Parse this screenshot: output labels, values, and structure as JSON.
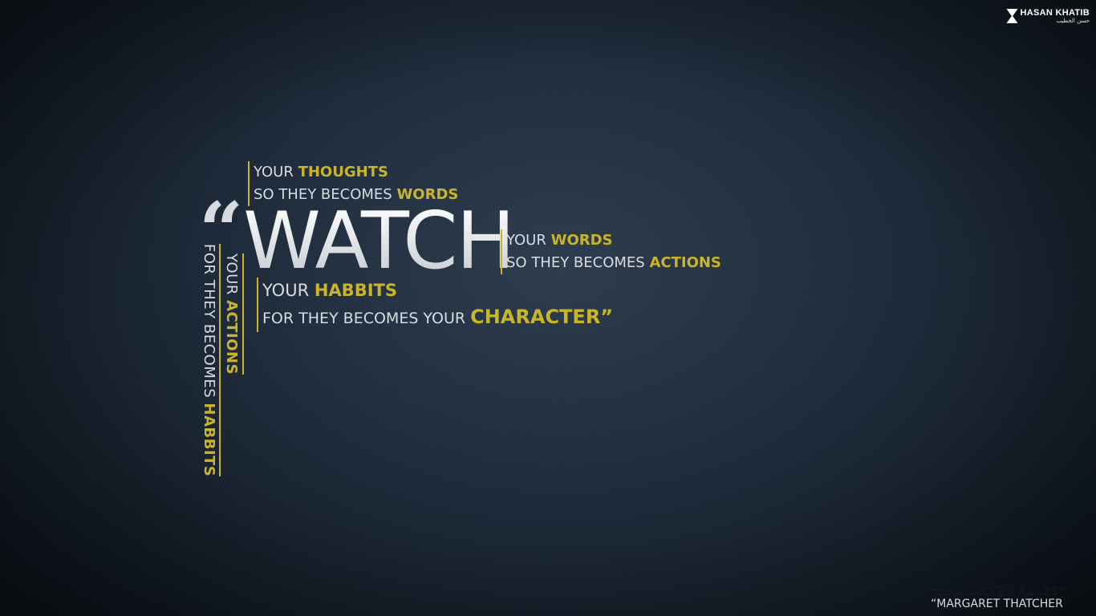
{
  "colors": {
    "accent": "#c8b52a",
    "text": "#d8dce0",
    "background": "#1c2836"
  },
  "logo": {
    "icon": "hk-logo-icon",
    "name": "HASAN KHATIB",
    "subtitle": "حسن الخطيب"
  },
  "quote": {
    "open_mark": "“",
    "main_word": "WATCH",
    "block_thoughts": {
      "line1_white": "YOUR ",
      "line1_yellow": "THOUGHTS",
      "line2_white": "SO THEY BECOMES ",
      "line2_yellow": "WORDS"
    },
    "block_words": {
      "line1_white": "YOUR ",
      "line1_yellow": "WORDS",
      "line2_white": "SO THEY BECOMES ",
      "line2_yellow": "ACTIONS"
    },
    "block_habits": {
      "line1_white": "YOUR ",
      "line1_yellow": "HABBITS",
      "line2_white": "FOR THEY BECOMES YOUR ",
      "line2_yellow": "CHARACTER”"
    },
    "vertical_actions": {
      "white": "YOUR ",
      "yellow": "ACTIONS"
    },
    "vertical_habits": {
      "white": "FOR THEY BECOMES ",
      "yellow": "HABBITS"
    }
  },
  "footer": {
    "rules": "“CHARACTER RULES”",
    "author": "“MARGARET THATCHER"
  }
}
